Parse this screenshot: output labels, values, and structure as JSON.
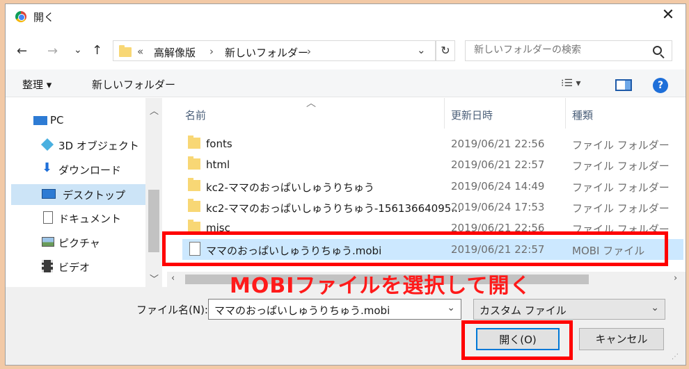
{
  "title": "開く",
  "nav": {
    "back": "←",
    "forward": "→",
    "recent": "⌄",
    "up": "↑",
    "overflow": "«",
    "path": [
      "高解像版",
      "新しいフォルダー"
    ],
    "separator": "›",
    "dropdown": "⌄",
    "refresh": "↻"
  },
  "search": {
    "placeholder": "新しいフォルダーの検索"
  },
  "toolbar": {
    "organize": "整理 ▾",
    "new_folder": "新しいフォルダー",
    "view": "⁝☰ ▾",
    "help": "?"
  },
  "sidebar": {
    "items": [
      {
        "label": "PC",
        "icon": "pc-icon"
      },
      {
        "label": "3D オブジェクト",
        "icon": "cube-icon"
      },
      {
        "label": "ダウンロード",
        "icon": "download-icon"
      },
      {
        "label": "デスクトップ",
        "icon": "desktop-icon",
        "selected": true
      },
      {
        "label": "ドキュメント",
        "icon": "document-icon"
      },
      {
        "label": "ピクチャ",
        "icon": "picture-icon"
      },
      {
        "label": "ビデオ",
        "icon": "video-icon"
      }
    ]
  },
  "columns": {
    "name": "名前",
    "date": "更新日時",
    "type": "種類"
  },
  "files": [
    {
      "name": "fonts",
      "date": "2019/06/21 22:56",
      "type": "ファイル フォルダー",
      "kind": "folder"
    },
    {
      "name": "html",
      "date": "2019/06/21 22:57",
      "type": "ファイル フォルダー",
      "kind": "folder"
    },
    {
      "name": "kc2-ママのおっぱいしゅうりちゅう",
      "date": "2019/06/24 14:49",
      "type": "ファイル フォルダー",
      "kind": "folder"
    },
    {
      "name": "kc2-ママのおっぱいしゅうりちゅう-15613664095...",
      "date": "2019/06/24 17:53",
      "type": "ファイル フォルダー",
      "kind": "folder"
    },
    {
      "name": "misc",
      "date": "2019/06/21 22:56",
      "type": "ファイル フォルダー",
      "kind": "folder"
    },
    {
      "name": "ママのおっぱいしゅうりちゅう.mobi",
      "date": "2019/06/21 22:57",
      "type": "MOBI ファイル",
      "kind": "file",
      "selected": true
    }
  ],
  "annotation": "MOBIファイルを選択して開く",
  "bottom": {
    "filename_label": "ファイル名(N):",
    "filename_value": "ママのおっぱいしゅうりちゅう.mobi",
    "filter_value": "カスタム ファイル",
    "open_label": "開く(O)",
    "cancel_label": "キャンセル"
  },
  "colors": {
    "annotation_red": "#ff0000",
    "selection": "#cce8ff",
    "folder": "#f8d775"
  }
}
